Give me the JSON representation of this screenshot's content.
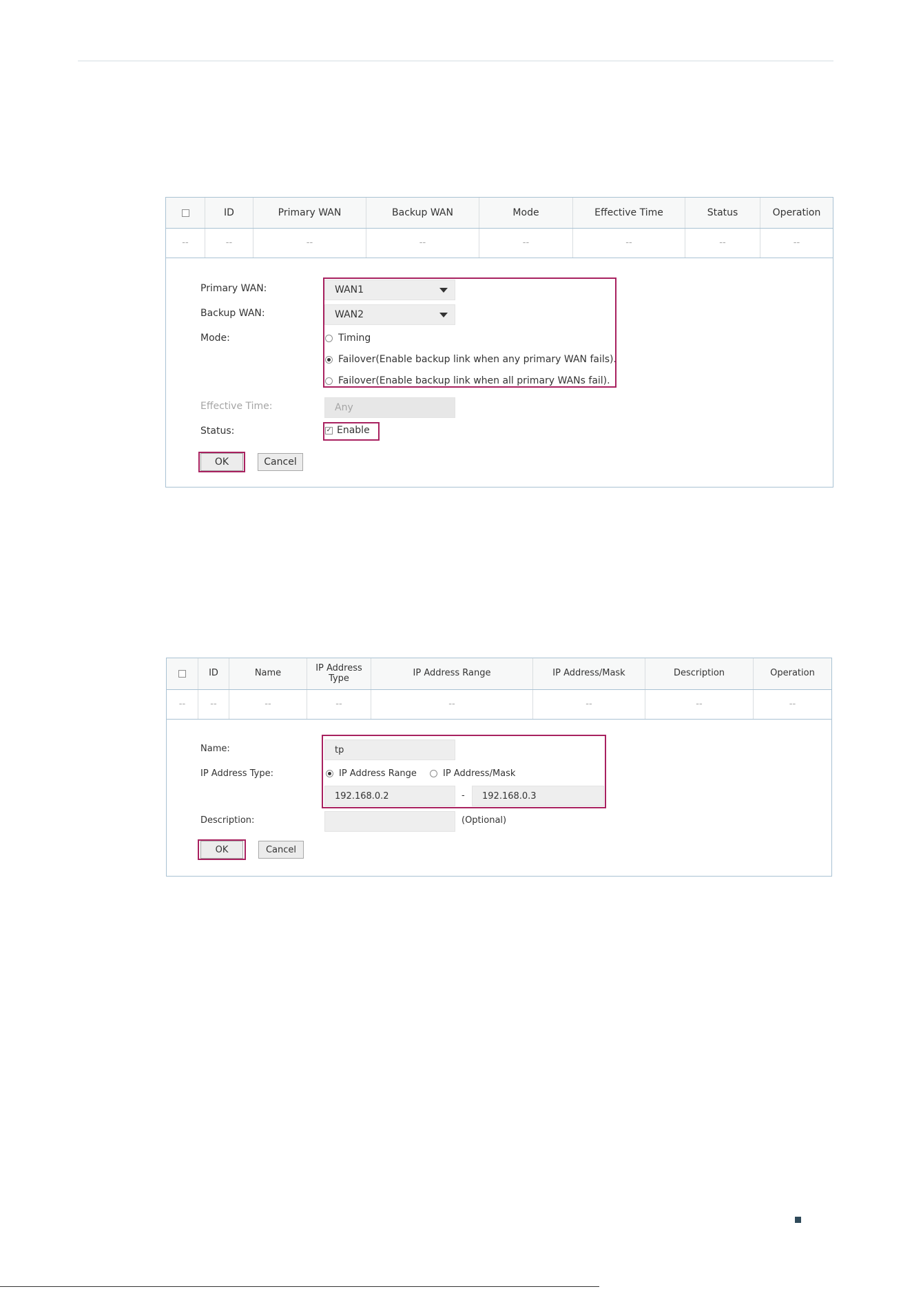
{
  "panel1": {
    "columns": [
      "ID",
      "Primary WAN",
      "Backup WAN",
      "Mode",
      "Effective Time",
      "Status",
      "Operation"
    ],
    "empty_row": [
      "--",
      "--",
      "--",
      "--",
      "--",
      "--",
      "--",
      "--"
    ],
    "form": {
      "primary_wan_label": "Primary WAN:",
      "primary_wan_value": "WAN1",
      "backup_wan_label": "Backup WAN:",
      "backup_wan_value": "WAN2",
      "mode_label": "Mode:",
      "mode_options": [
        "Timing",
        "Failover(Enable backup link when any primary WAN fails).",
        "Failover(Enable backup link when all primary WANs fail)."
      ],
      "mode_selected_index": 1,
      "effective_time_label": "Effective Time:",
      "effective_time_value": "Any",
      "status_label": "Status:",
      "status_checkbox_label": "Enable",
      "status_checked": true,
      "ok_label": "OK",
      "cancel_label": "Cancel"
    }
  },
  "panel2": {
    "columns": [
      "ID",
      "Name",
      "IP Address Type",
      "IP Address Range",
      "IP Address/Mask",
      "Description",
      "Operation"
    ],
    "empty_row": [
      "--",
      "--",
      "--",
      "--",
      "--",
      "--",
      "--",
      "--"
    ],
    "form": {
      "name_label": "Name:",
      "name_value": "tp",
      "ip_type_label": "IP Address Type:",
      "ip_type_options": [
        "IP Address Range",
        "IP Address/Mask"
      ],
      "ip_type_selected_index": 0,
      "range_start": "192.168.0.2",
      "range_separator": "-",
      "range_end": "192.168.0.3",
      "description_label": "Description:",
      "description_value": "",
      "description_hint": "(Optional)",
      "ok_label": "OK",
      "cancel_label": "Cancel"
    }
  },
  "colors": {
    "highlight": "#a8215f",
    "table_border": "#a9c2d3",
    "field_bg": "#eeeeee"
  }
}
